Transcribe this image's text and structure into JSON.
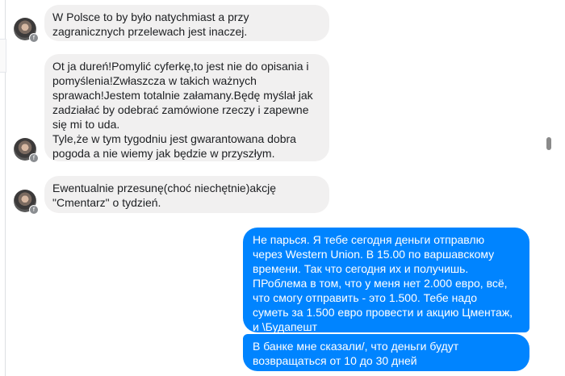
{
  "messages": [
    {
      "id": "m1",
      "direction": "incoming",
      "text": "W Polsce to by było natychmiast a przy\nzagranicznych przelewach jest inaczej."
    },
    {
      "id": "m2",
      "direction": "incoming",
      "text": "Ot ja dureń!Pomylić cyferkę,to jest nie do opisania i\npomyślenia!Zwłaszcza w takich ważnych\nsprawach!Jestem totalnie załamany.Będę myślał jak\nzadziałać by odebrać zamówione rzeczy i zapewne\nsię mi to uda.\nTyle,że w tym tygodniu jest gwarantowana dobra\npogoda a nie wiemy jak będzie w przyszłym."
    },
    {
      "id": "m3",
      "direction": "incoming",
      "text": "Ewentualnie przesunę(choć niechętnie)akcję\n\"Cmentarz\" o tydzień."
    },
    {
      "id": "m4",
      "direction": "outgoing",
      "text": "Не парься. Я тебе сегодня деньги отправлю\nчерез Western Union. В 15.00 по варшавскому\nвремени. Так что сегодня их и получишь.\nПРоблема в том, что у меня нет 2.000 евро, всё,\nчто смогу отправить - это 1.500. Тебе надо\nсуметь за 1.500 евро провести и акцию Цментаж,\nи \\Будапешт"
    },
    {
      "id": "m5",
      "direction": "outgoing",
      "text": "В банке мне сказали/, что деньги будут\nвозвращаться от 10 до 30 дней"
    }
  ],
  "avatar": {
    "badge_icon": "messenger-badge-icon"
  }
}
